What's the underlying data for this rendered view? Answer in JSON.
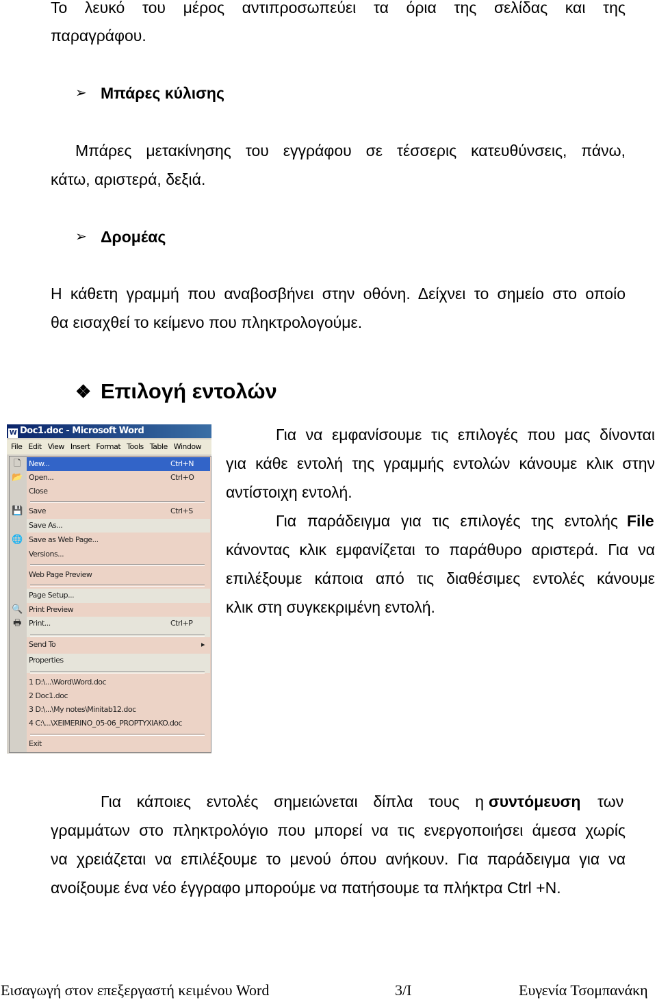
{
  "intro_lines": [
    "Το λευκό του μέρος αντιπροσωπεύει τα όρια της σελίδας και της",
    "παραγράφου."
  ],
  "scrollbars": {
    "heading": "Μπάρες κύλισης",
    "lines": [
      "Μπάρες μετακίνησης του εγγράφου σε τέσσερις κατευθύνσεις, πάνω,",
      "κάτω, αριστερά, δεξιά."
    ]
  },
  "cursor": {
    "heading": "Δρομέας",
    "lines": [
      "Η κάθετη γραμμή που αναβοσβήνει στην οθόνη. Δείχνει το σημείο στο οποίο",
      "θα εισαχθεί το κείμενο που πληκτρολογούμε."
    ]
  },
  "section": {
    "heading": "Επιλογή εντολών",
    "lines": [
      "Για να εμφανίσουμε τις επιλογές που μας δίνονται",
      "για κάθε εντολή της γραμμής εντολών κάνουμε κλικ στην",
      "αντίστοιχη εντολή.",
      "Για παράδειγμα για τις επιλογές της εντολής",
      "File",
      "κάνοντας κλικ εμφανίζεται το παράθυρο αριστερά. Για να",
      "επιλέξουμε κάποια από τις διαθέσιμες εντολές κάνουμε",
      "κλικ στη συγκεκριμένη εντολή."
    ]
  },
  "word": {
    "title": "Doc1.doc - Microsoft Word",
    "menubar": [
      "File",
      "Edit",
      "View",
      "Insert",
      "Format",
      "Tools",
      "Table",
      "Window"
    ],
    "items": [
      {
        "label": "New...",
        "shortcut": "Ctrl+N",
        "icon": "new-document-icon"
      },
      {
        "label": "Open...",
        "shortcut": "Ctrl+O",
        "icon": "open-folder-icon"
      },
      {
        "label": "Close"
      },
      {
        "label": "Save",
        "shortcut": "Ctrl+S",
        "icon": "save-disk-icon"
      },
      {
        "label": "Save As..."
      },
      {
        "label": "Save as Web Page...",
        "icon": "web-page-icon"
      },
      {
        "label": "Versions..."
      },
      {
        "label": "Web Page Preview"
      },
      {
        "label": "Page Setup..."
      },
      {
        "label": "Print Preview",
        "icon": "print-preview-icon"
      },
      {
        "label": "Print...",
        "shortcut": "Ctrl+P",
        "icon": "printer-icon"
      },
      {
        "label": "Send To",
        "submenu": "▸"
      },
      {
        "label": "Properties"
      },
      {
        "label": "1 D:\\...\\Word\\Word.doc"
      },
      {
        "label": "2 Doc1.doc"
      },
      {
        "label": "3 D:\\...\\My notes\\Minitab12.doc"
      },
      {
        "label": "4 C:\\...\\XEIMERINO_05-06_PROPTYXIAKO.doc"
      },
      {
        "label": "Exit"
      }
    ]
  },
  "shortcuts": {
    "lines": [
      "Για κάποιες εντολές σημειώνεται δίπλα τους η",
      "συντόμευση",
      "των",
      "γραμμάτων στο πληκτρολόγιο που μπορεί να τις ενεργοποιήσει άμεσα χωρίς",
      "να χρειάζεται να επιλέξουμε το μενού όπου ανήκουν. Για παράδειγμα για να",
      "ανοίξουμε ένα νέο έγγραφο μπορούμε να πατήσουμε τα πλήκτρα Ctrl +N."
    ]
  },
  "footer": {
    "left": "Εισαγωγή στον επεξεργαστή κειμένου Word",
    "center": "3/I",
    "right": "Ευγενία Τσομπανάκη"
  }
}
